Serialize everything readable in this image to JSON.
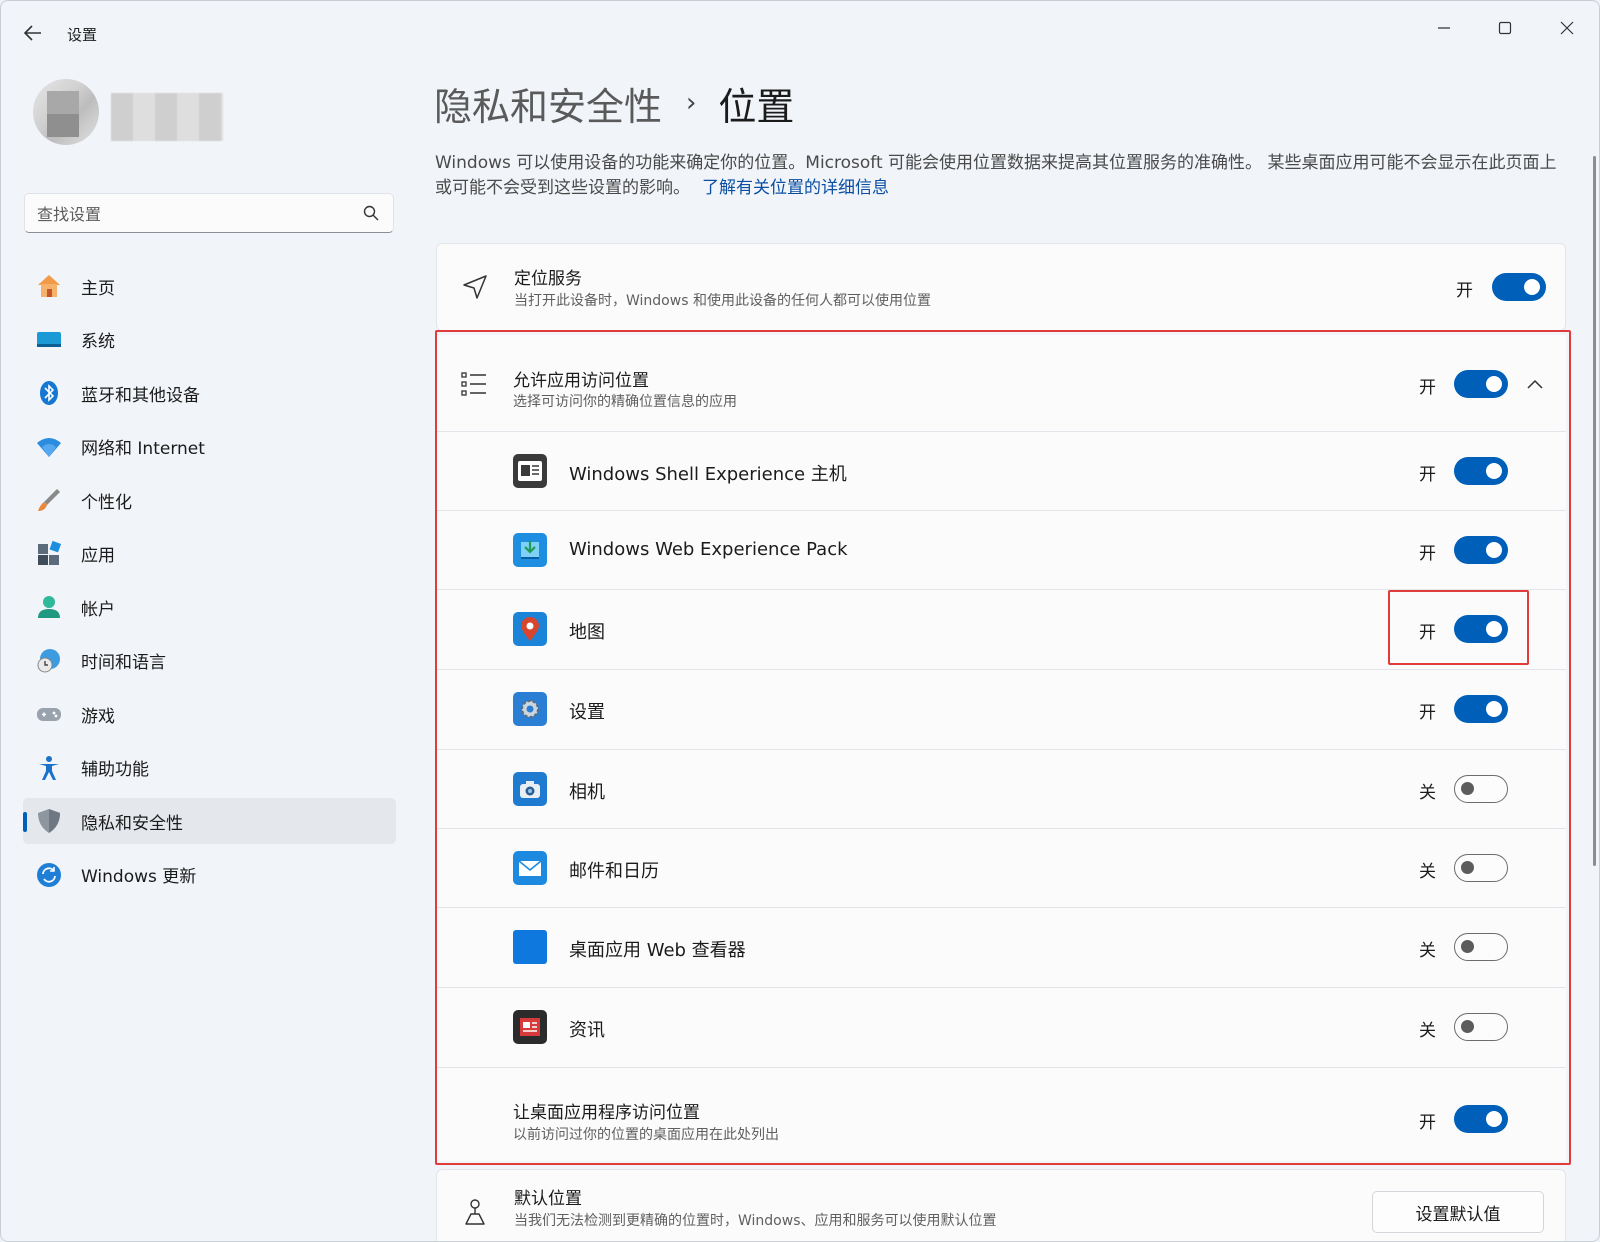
{
  "window": {
    "app_title": "设置",
    "back_icon": "arrow-left-icon",
    "controls": [
      "minimize-icon",
      "maximize-icon",
      "close-icon"
    ]
  },
  "sidebar": {
    "search_placeholder": "查找设置",
    "items": [
      {
        "label": "主页",
        "icon": "home-icon",
        "active": false
      },
      {
        "label": "系统",
        "icon": "system-icon",
        "active": false
      },
      {
        "label": "蓝牙和其他设备",
        "icon": "bluetooth-icon",
        "active": false
      },
      {
        "label": "网络和 Internet",
        "icon": "wifi-icon",
        "active": false
      },
      {
        "label": "个性化",
        "icon": "brush-icon",
        "active": false
      },
      {
        "label": "应用",
        "icon": "apps-icon",
        "active": false
      },
      {
        "label": "帐户",
        "icon": "account-icon",
        "active": false
      },
      {
        "label": "时间和语言",
        "icon": "time-language-icon",
        "active": false
      },
      {
        "label": "游戏",
        "icon": "gamepad-icon",
        "active": false
      },
      {
        "label": "辅助功能",
        "icon": "accessibility-icon",
        "active": false
      },
      {
        "label": "隐私和安全性",
        "icon": "shield-icon",
        "active": true
      },
      {
        "label": "Windows 更新",
        "icon": "update-icon",
        "active": false
      }
    ]
  },
  "main": {
    "breadcrumb": {
      "parent": "隐私和安全性",
      "separator": "›",
      "current": "位置"
    },
    "description": "Windows 可以使用设备的功能来确定你的位置。Microsoft 可能会使用位置数据来提高其位置服务的准确性。 某些桌面应用可能不会显示在此页面上或可能不会受到这些设置的影响。",
    "learn_more_link": "了解有关位置的详细信息",
    "location_service": {
      "title": "定位服务",
      "subtitle": "当打开此设备时，Windows 和使用此设备的任何人都可以使用位置",
      "state": "开",
      "on": true
    },
    "app_access": {
      "title": "允许应用访问位置",
      "subtitle": "选择可访问你的精确位置信息的应用",
      "state": "开",
      "on": true,
      "expanded": true
    },
    "apps": [
      {
        "name": "Windows Shell Experience 主机",
        "icon": "shell-experience-icon",
        "state": "开",
        "on": true
      },
      {
        "name": "Windows Web Experience Pack",
        "icon": "web-experience-icon",
        "state": "开",
        "on": true
      },
      {
        "name": "地图",
        "icon": "maps-icon",
        "state": "开",
        "on": true
      },
      {
        "name": "设置",
        "icon": "settings-gear-icon",
        "state": "开",
        "on": true
      },
      {
        "name": "相机",
        "icon": "camera-icon",
        "state": "关",
        "on": false
      },
      {
        "name": "邮件和日历",
        "icon": "mail-icon",
        "state": "关",
        "on": false
      },
      {
        "name": "桌面应用 Web 查看器",
        "icon": "web-viewer-icon",
        "state": "关",
        "on": false
      },
      {
        "name": "资讯",
        "icon": "news-icon",
        "state": "关",
        "on": false
      }
    ],
    "desktop_apps": {
      "title": "让桌面应用程序访问位置",
      "subtitle": "以前访问过你的位置的桌面应用在此处列出",
      "state": "开",
      "on": true
    },
    "default_location": {
      "title": "默认位置",
      "subtitle": "当我们无法检测到更精确的位置时，Windows、应用和服务可以使用默认位置",
      "button": "设置默认值"
    }
  },
  "colors": {
    "accent": "#005fb8",
    "highlight": "#e03c3c",
    "link": "#0b4fa3"
  }
}
